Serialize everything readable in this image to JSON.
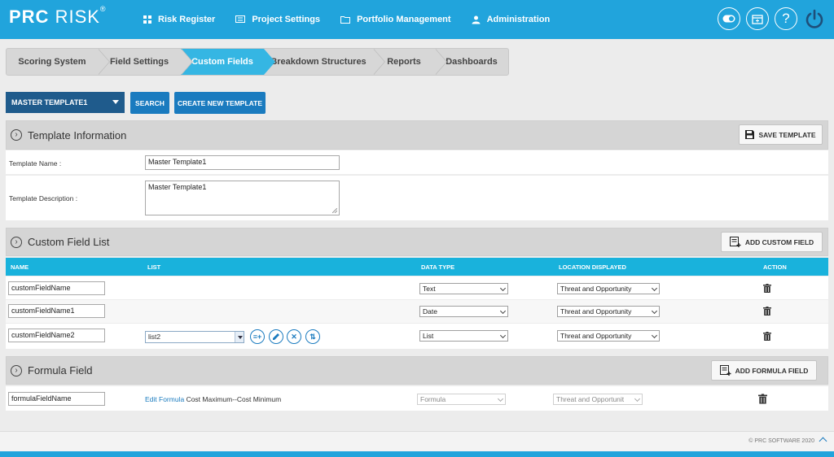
{
  "header": {
    "logo_bold": "PRC",
    "logo_light": " RISK",
    "logo_reg": "®",
    "nav": [
      {
        "label": "Risk Register",
        "icon": "grid-icon"
      },
      {
        "label": "Project Settings",
        "icon": "settings-panel-icon"
      },
      {
        "label": "Portfolio Management",
        "icon": "folder-icon"
      },
      {
        "label": "Administration",
        "icon": "user-icon"
      }
    ],
    "icons": [
      "toggle-icon",
      "calendar-icon",
      "help-icon",
      "power-icon"
    ]
  },
  "tabs": [
    {
      "label": "Scoring System",
      "active": false
    },
    {
      "label": "Field Settings",
      "active": false
    },
    {
      "label": "Custom Fields",
      "active": true
    },
    {
      "label": "Breakdown Structures",
      "active": false
    },
    {
      "label": "Reports",
      "active": false
    },
    {
      "label": "Dashboards",
      "active": false
    }
  ],
  "toolbar": {
    "template_selected": "MASTER TEMPLATE1",
    "search_label": "SEARCH",
    "create_label": "CREATE NEW TEMPLATE"
  },
  "template_info": {
    "title": "Template Information",
    "save_label": "SAVE TEMPLATE",
    "name_label": "Template Name :",
    "name_value": "Master Template1",
    "desc_label": "Template Description :",
    "desc_value": "Master Template1"
  },
  "custom_fields": {
    "title": "Custom Field List",
    "add_label": "ADD CUSTOM FIELD",
    "columns": {
      "name": "NAME",
      "list": "LIST",
      "data_type": "DATA TYPE",
      "location": "LOCATION DISPLAYED",
      "action": "ACTION"
    },
    "rows": [
      {
        "name": "customFieldName",
        "list": "",
        "data_type": "Text",
        "location": "Threat and Opportunity"
      },
      {
        "name": "customFieldName1",
        "list": "",
        "data_type": "Date",
        "location": "Threat and Opportunity"
      },
      {
        "name": "customFieldName2",
        "list": "list2",
        "data_type": "List",
        "location": "Threat and Opportunity"
      }
    ]
  },
  "formula_fields": {
    "title": "Formula Field",
    "add_label": "ADD FORMULA FIELD",
    "rows": [
      {
        "name": "formulaFieldName",
        "edit_label": "Edit Formula",
        "formula": "Cost Maximum--Cost Minimum",
        "data_type": "Formula",
        "location": "Threat and Opportunit"
      }
    ]
  },
  "footer": {
    "copyright": "© PRC SOFTWARE 2020"
  }
}
